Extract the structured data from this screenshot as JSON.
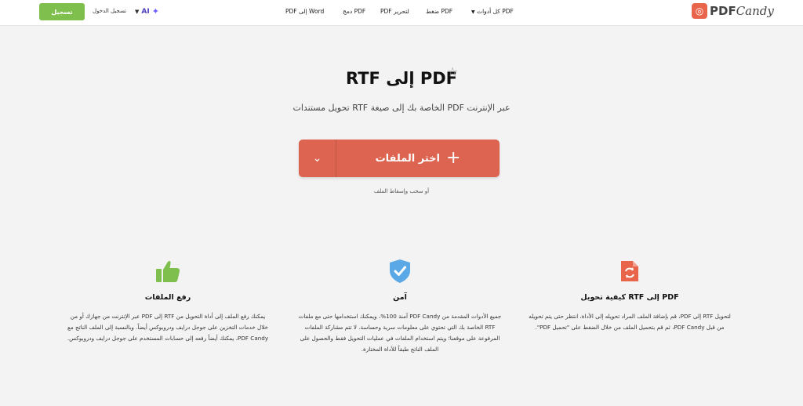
{
  "header": {
    "signup_label": "تسجيل",
    "login_label": "تسجيل الدخول",
    "ai_label": "AI",
    "nav": {
      "all_tools": "كل أدوات PDF",
      "compress": "ضغط PDF",
      "edit": "PDF لتحرير",
      "merge": "دمج PDF",
      "pdf_to_word": "PDF إلى Word"
    },
    "logo_pdf": "PDF",
    "logo_candy": "Candy"
  },
  "hero": {
    "title": "RTF إلى PDF",
    "subtitle": "تحويل مستندات RTF الخاصة بك إلى صيغة PDF عبر الإنترنت",
    "choose_files": "اختر الملفات",
    "drag_hint": "أو سحب وإسقاط الملف"
  },
  "features": [
    {
      "icon": "convert-icon",
      "title": "كيفية تحويل RTF إلى PDF",
      "text": "لتحويل RTF إلى PDF، قم بإضافة الملف المراد تحويله إلى الأداة، انتظر حتى يتم تحويله من قبل PDF Candy، ثم قم بتحميل الملف من خلال الضغط على \"تحميل PDF\"."
    },
    {
      "icon": "shield-check-icon",
      "title": "آمن",
      "text": "جميع الأدوات المقدمة من PDF Candy آمنة 100%، ويمكنك استخدامها حتى مع ملفات RTF الخاصة بك التي تحتوي على معلومات سرية وحساسة. لا تتم مشاركة الملفات المرفوعة على موقعنا؛ ويتم استخدام الملفات في عمليات التحويل فقط والحصول على الملف الناتج طبقاً للأداة المختارة."
    },
    {
      "icon": "thumbs-up-icon",
      "title": "رفع الملفات",
      "text": "يمكنك رفع الملف إلى أداة التحويل من RTF إلى PDF عبر الإنترنت من جهازك أو من خلال خدمات التخزين على جوجل درايف ودروبوكس أيضاً. وبالنسبة إلى الملف الناتج مع PDF Candy، يمكنك أيضاً رفعه إلى حسابات المستخدم على جوجل درايف ودروبوكس."
    }
  ],
  "colors": {
    "accent": "#dc6450",
    "signup": "#7fbf4d",
    "icon_green": "#7fbf4d",
    "icon_blue": "#5aa9e6",
    "icon_orange": "#e8654b"
  }
}
